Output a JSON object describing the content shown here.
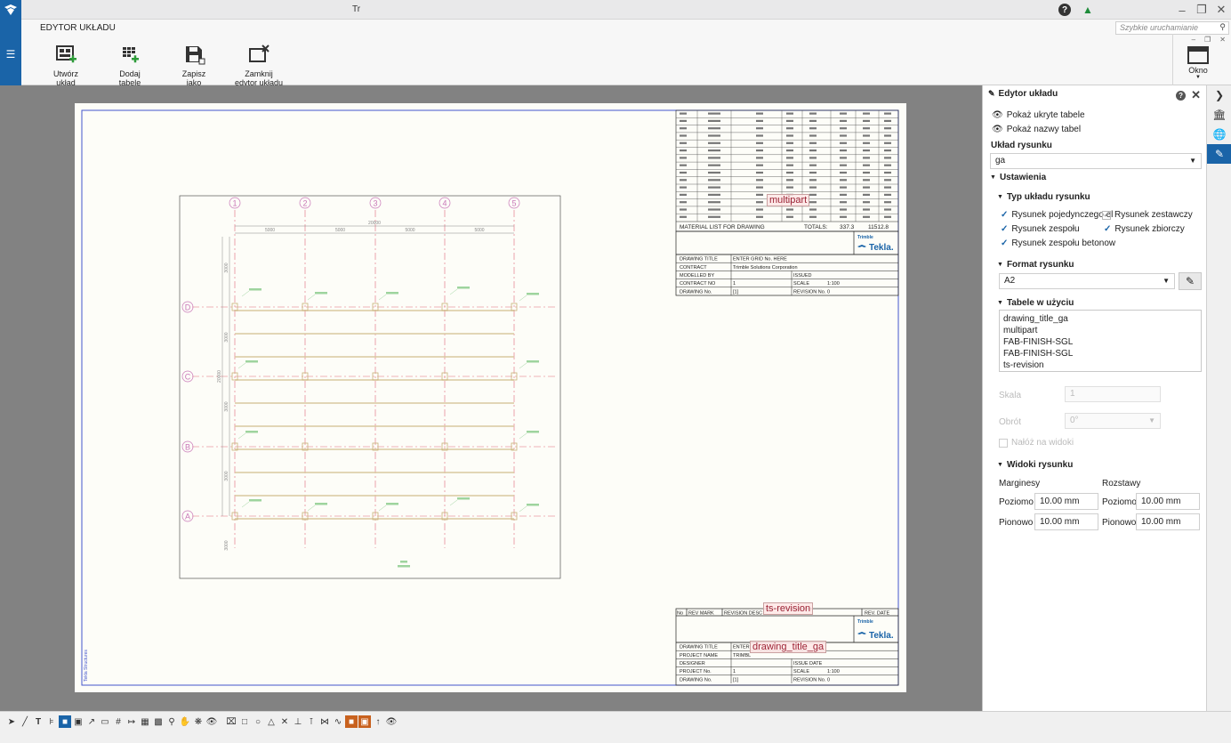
{
  "window": {
    "title": "Tr"
  },
  "quick_launch": {
    "placeholder": "Szybkie uruchamianie"
  },
  "ribbon": {
    "tab": "EDYTOR UKŁADU",
    "buttons": [
      {
        "label": "Utwórz układ"
      },
      {
        "label": "Dodaj tabele"
      },
      {
        "label": "Zapisz jako"
      },
      {
        "label": "Zamknij edytor układu"
      }
    ],
    "okno_label": "Okno"
  },
  "drawing": {
    "tag_multipart": "multipart",
    "tag_revision": "ts-revision",
    "tag_title": "drawing_title_ga",
    "material_list_title": "MATERIAL LIST FOR DRAWING",
    "totals_label": "TOTALS:",
    "totals_1": "337.3",
    "totals_2": "11512.8",
    "title_block_top": {
      "rows": [
        {
          "k": "DRAWING TITLE",
          "v": "ENTER GRID No. HERE",
          "k2": "",
          "v2": ""
        },
        {
          "k": "CONTRACT",
          "v": "Trimble Solutions Corporation",
          "k2": "",
          "v2": ""
        },
        {
          "k": "MODELLED BY",
          "v": "",
          "k2": "ISSUED",
          "v2": ""
        },
        {
          "k": "CONTRACT NO",
          "v": "1",
          "k2": "SCALE",
          "v2": "1:100"
        },
        {
          "k": "DRAWING No.",
          "v": "[1]",
          "k2": "REVISION No.",
          "v2": "0"
        }
      ]
    },
    "revision_header": {
      "no": "No",
      "mark": "REV MARK",
      "desc": "REVISION DESC",
      "date": "REV. DATE"
    },
    "title_block_bottom": {
      "rows": [
        {
          "k": "DRAWING TITLE",
          "v": "ENTER",
          "k2": "",
          "v2": ""
        },
        {
          "k": "PROJECT NAME",
          "v": "TRIMBL",
          "k2": "",
          "v2": ""
        },
        {
          "k": "DESIGNER",
          "v": "",
          "k2": "ISSUE DATE",
          "v2": ""
        },
        {
          "k": "PROJECT No.",
          "v": "1",
          "k2": "SCALE",
          "v2": "1:100"
        },
        {
          "k": "DRAWING No.",
          "v": "[1]",
          "k2": "REVISION No.",
          "v2": "0"
        }
      ]
    },
    "brand": "Tekla.",
    "brand_small": "Trimble",
    "grid_numbers": [
      "1",
      "2",
      "3",
      "4",
      "5"
    ],
    "grid_letters": [
      "D",
      "C",
      "B",
      "A"
    ],
    "dim_total": "20000",
    "dim_parts": [
      "5000",
      "5000",
      "5000",
      "5000"
    ],
    "dim_vertical": [
      "3000",
      "3000",
      "3000",
      "3000",
      "3000"
    ],
    "dim_vertical_total": "20000",
    "side_note": "Tekla Structures"
  },
  "panel": {
    "title": "Edytor układu",
    "show_hidden": "Pokaż ukryte tabele",
    "show_names": "Pokaż nazwy tabel",
    "layout_label": "Układ rysunku",
    "layout_value": "ga",
    "settings": "Ustawienia",
    "type_section": "Typ układu rysunku",
    "types": [
      {
        "label": "Rysunek pojedynczego el",
        "checked": true
      },
      {
        "label": "Rysunek zestawczy",
        "checked": true
      },
      {
        "label": "Rysunek zespołu",
        "checked": true
      },
      {
        "label": "Rysunek zbiorczy",
        "checked": true
      },
      {
        "label": "Rysunek zespołu betonow",
        "checked": true
      }
    ],
    "format_section": "Format rysunku",
    "format_value": "A2",
    "tables_section": "Tabele w użyciu",
    "tables": [
      "drawing_title_ga",
      "multipart",
      "FAB-FINISH-SGL",
      "FAB-FINISH-SGL",
      "ts-revision"
    ],
    "scale_label": "Skala",
    "scale_value": "1",
    "rotation_label": "Obrót",
    "rotation_value": "0°",
    "overlay_label": "Nałóż na widoki",
    "views_section": "Widoki rysunku",
    "margins_label": "Marginesy",
    "spacing_label": "Rozstawy",
    "horizontal": "Poziomo",
    "vertical": "Pionowo",
    "margin_h": "10.00 mm",
    "margin_v": "10.00 mm",
    "spacing_h": "10.00 mm",
    "spacing_v": "10.00 mm"
  }
}
